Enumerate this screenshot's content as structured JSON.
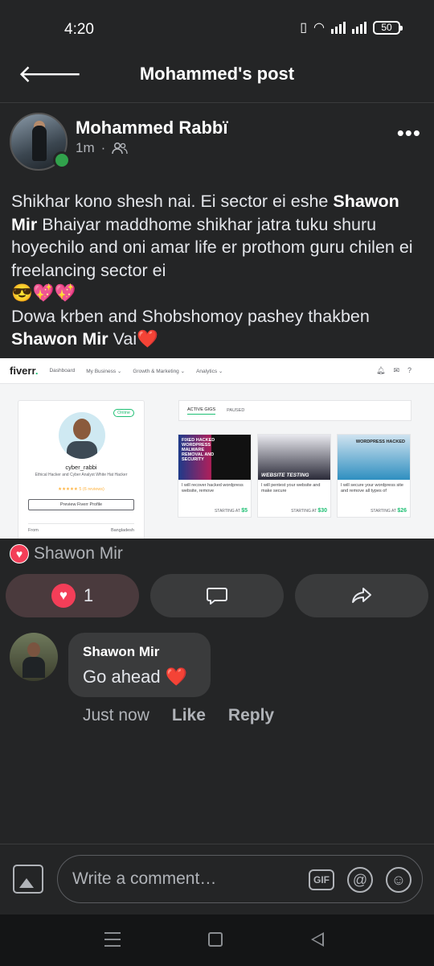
{
  "status_bar": {
    "time": "4:20",
    "battery": "50"
  },
  "header": {
    "title": "Mohammed's post"
  },
  "post": {
    "author": "Mohammed Rabbï",
    "time": "1m",
    "text": {
      "p1": "Shikhar kono shesh nai. Ei sector ei eshe ",
      "mention1": "Shawon Mir",
      "p2": " Bhaiyar maddhome shikhar jatra tuku shuru hoyechilo and oni amar life er prothom guru chilen ei freelancing sector ei ",
      "emoji1": "😎💖💖",
      "p3": "Dowa krben and Shobshomoy pashey thakben ",
      "mention2": "Shawon Mir",
      "p4": " Vai",
      "emoji2": "❤️"
    },
    "image": {
      "logo": "fiverr",
      "nav": [
        "Dashboard",
        "My Business ⌄",
        "Growth & Marketing ⌄",
        "Analytics ⌄"
      ],
      "profile": {
        "username": "cyber_rabbi",
        "status": "Online",
        "description": "Ethical Hacker and Cyber Analyst White Hat Hacker",
        "rating": "★★★★★ 5 (6 reviews)",
        "preview_button": "Preview Fiverr Profile",
        "from_label": "From",
        "from_value": "Bangladesh"
      },
      "tabs": [
        "ACTIVE GIGS",
        "PAUSED"
      ],
      "gigs": [
        {
          "thumb": "FIXED HACKED WORDPRESS MALWARE REMOVAL AND SECURITY",
          "title": "I will recover hacked wordpress website, remove",
          "price_label": "STARTING AT",
          "price": "$5"
        },
        {
          "thumb": "WEBSITE TESTING",
          "title": "I will pentest your website and make secure",
          "price_label": "STARTING AT",
          "price": "$30"
        },
        {
          "thumb": "WORDPRESS HACKED",
          "title": "I will secure your wordpress site and remove all types of",
          "price_label": "STARTING AT",
          "price": "$26"
        }
      ]
    },
    "reactions_summary": "Shawon Mir",
    "like_count": "1"
  },
  "comment": {
    "author": "Shawon Mir",
    "text": "Go ahead ",
    "emoji": "❤️",
    "time": "Just now",
    "like_label": "Like",
    "reply_label": "Reply"
  },
  "composer": {
    "placeholder": "Write a comment…",
    "gif_label": "GIF",
    "at_label": "@",
    "smile_label": "☺"
  },
  "colors": {
    "background": "#242526",
    "like_red": "#f33e58",
    "online_green": "#31a24c",
    "fiverr_green": "#1dbf73"
  }
}
